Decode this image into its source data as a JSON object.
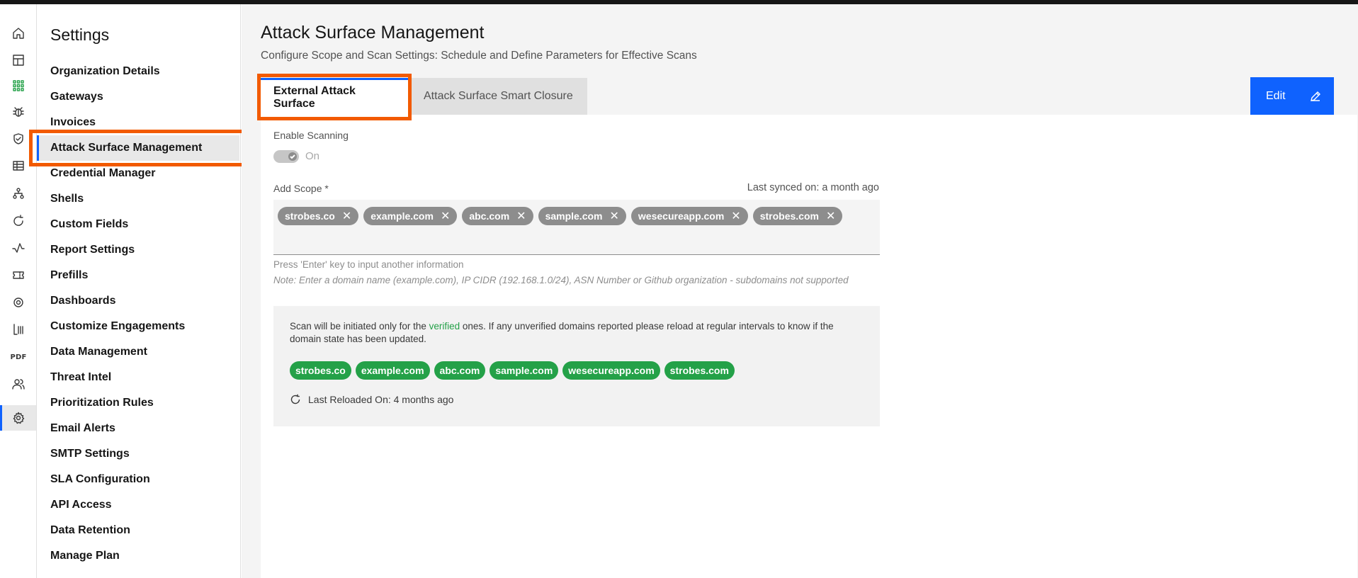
{
  "rail": {
    "icons": [
      "home-icon",
      "dashboard-icon",
      "apps-icon",
      "bug-icon",
      "shield-check-icon",
      "table-icon",
      "network-icon",
      "refresh-icon",
      "activity-icon",
      "ticket-icon",
      "scan-icon",
      "report-icon",
      "pdf-icon",
      "users-icon",
      "settings-icon"
    ],
    "pdf_label": "PDF"
  },
  "sidebar": {
    "title": "Settings",
    "items": [
      {
        "label": "Organization Details"
      },
      {
        "label": "Gateways"
      },
      {
        "label": "Invoices"
      },
      {
        "label": "Attack Surface Management",
        "active": true
      },
      {
        "label": "Credential Manager"
      },
      {
        "label": "Shells"
      },
      {
        "label": "Custom Fields"
      },
      {
        "label": "Report Settings"
      },
      {
        "label": "Prefills"
      },
      {
        "label": "Dashboards"
      },
      {
        "label": "Customize Engagements"
      },
      {
        "label": "Data Management"
      },
      {
        "label": "Threat Intel"
      },
      {
        "label": "Prioritization Rules"
      },
      {
        "label": "Email Alerts"
      },
      {
        "label": "SMTP Settings"
      },
      {
        "label": "SLA Configuration"
      },
      {
        "label": "API Access"
      },
      {
        "label": "Data Retention"
      },
      {
        "label": "Manage Plan"
      }
    ]
  },
  "header": {
    "title": "Attack Surface Management",
    "subtitle": "Configure Scope and Scan Settings: Schedule and Define Parameters for Effective Scans"
  },
  "tabs": [
    {
      "label": "External Attack Surface",
      "active": true
    },
    {
      "label": "Attack Surface Smart Closure",
      "active": false
    }
  ],
  "edit_button": {
    "label": "Edit"
  },
  "form": {
    "enable_scanning_label": "Enable Scanning",
    "toggle_state": "On",
    "add_scope_label": "Add Scope *",
    "last_synced": "Last synced on: a month ago",
    "scope_chips": [
      "strobes.co",
      "example.com",
      "abc.com",
      "sample.com",
      "wesecureapp.com",
      "strobes.com"
    ],
    "hint_enter": "Press 'Enter' key to input another information",
    "hint_note": "Note: Enter a domain name (example.com), IP CIDR (192.168.1.0/24), ASN Number or Github organization - subdomains not supported"
  },
  "info": {
    "text_before": "Scan will be initiated only for the ",
    "verified_word": "verified",
    "text_after": " ones. If any unverified domains reported please reload at regular intervals to know if the domain state has been updated.",
    "verified_chips": [
      "strobes.co",
      "example.com",
      "abc.com",
      "sample.com",
      "wesecureapp.com",
      "strobes.com"
    ],
    "last_reloaded": "Last Reloaded On: 4 months ago"
  },
  "colors": {
    "accent": "#0f62fe",
    "highlight": "#f25a00",
    "verified": "#24a148",
    "chip_gray": "#8d8d8d"
  }
}
